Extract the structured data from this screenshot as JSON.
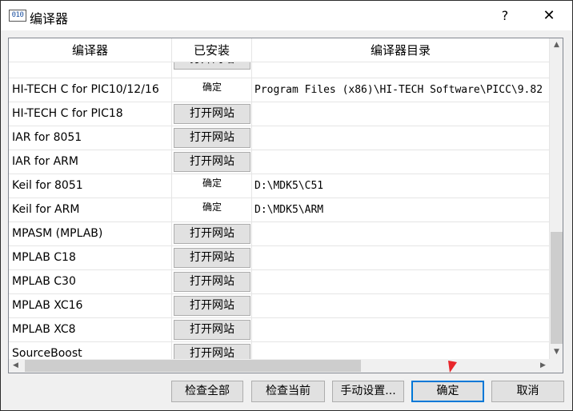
{
  "window": {
    "title": "编译器",
    "app_icon_text": "010",
    "help_label": "?",
    "close_label": "✕"
  },
  "table": {
    "columns": [
      "编译器",
      "已安装",
      "编译器目录"
    ],
    "partial_top_button": "打开网站",
    "rows": [
      {
        "name": "HI-TECH C for PIC10/12/16",
        "installed": true,
        "status_label": "确定",
        "directory": "Program Files (x86)\\HI-TECH Software\\PICC\\9.82"
      },
      {
        "name": "HI-TECH C for PIC18",
        "installed": false,
        "button_label": "打开网站",
        "directory": ""
      },
      {
        "name": "IAR for 8051",
        "installed": false,
        "button_label": "打开网站",
        "directory": ""
      },
      {
        "name": "IAR for ARM",
        "installed": false,
        "button_label": "打开网站",
        "directory": ""
      },
      {
        "name": "Keil for 8051",
        "installed": true,
        "status_label": "确定",
        "directory": "D:\\MDK5\\C51"
      },
      {
        "name": "Keil for ARM",
        "installed": true,
        "status_label": "确定",
        "directory": "D:\\MDK5\\ARM"
      },
      {
        "name": "MPASM (MPLAB)",
        "installed": false,
        "button_label": "打开网站",
        "directory": ""
      },
      {
        "name": "MPLAB C18",
        "installed": false,
        "button_label": "打开网站",
        "directory": ""
      },
      {
        "name": "MPLAB C30",
        "installed": false,
        "button_label": "打开网站",
        "directory": ""
      },
      {
        "name": "MPLAB XC16",
        "installed": false,
        "button_label": "打开网站",
        "directory": ""
      },
      {
        "name": "MPLAB XC8",
        "installed": false,
        "button_label": "打开网站",
        "directory": ""
      },
      {
        "name": "SourceBoost",
        "installed": false,
        "button_label": "打开网站",
        "directory": ""
      }
    ]
  },
  "scrollbars": {
    "up_icon": "▲",
    "down_icon": "▼",
    "left_icon": "◀",
    "right_icon": "▶"
  },
  "buttons": {
    "check_all": "检查全部",
    "check_current": "检查当前",
    "manual_setup": "手动设置...",
    "ok": "确定",
    "cancel": "取消"
  },
  "colors": {
    "annotation_arrow": "#e8262b",
    "focus_border": "#0078d7"
  }
}
